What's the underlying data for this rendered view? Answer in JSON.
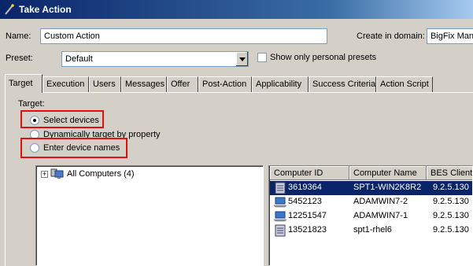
{
  "window": {
    "title": "Take Action"
  },
  "form": {
    "name_label": "Name:",
    "name_value": "Custom Action",
    "domain_label": "Create in domain:",
    "domain_value": "BigFix Mana",
    "preset_label": "Preset:",
    "preset_value": "Default",
    "personal_presets_label": "Show only personal presets",
    "personal_presets_checked": false
  },
  "tabs": [
    {
      "label": "Target",
      "active": true
    },
    {
      "label": "Execution"
    },
    {
      "label": "Users"
    },
    {
      "label": "Messages"
    },
    {
      "label": "Offer"
    },
    {
      "label": "Post-Action"
    },
    {
      "label": "Applicability"
    },
    {
      "label": "Success Criteria"
    },
    {
      "label": "Action Script"
    }
  ],
  "target": {
    "group_label": "Target:",
    "options": [
      {
        "label": "Select devices",
        "selected": true
      },
      {
        "label": "Dynamically target by property",
        "selected": false
      },
      {
        "label": "Enter device names",
        "selected": false
      }
    ]
  },
  "tree": {
    "expander": "+",
    "root_label": "All Computers (4)"
  },
  "computers": {
    "columns": [
      "Computer ID",
      "Computer Name",
      "BES Client Version"
    ],
    "rows": [
      {
        "id": "3619364",
        "name": "SPT1-WIN2K8R2",
        "version": "9.2.5.130",
        "icon": "server-icon",
        "selected": true
      },
      {
        "id": "5452123",
        "name": "ADAMWIN7-2",
        "version": "9.2.5.130",
        "icon": "laptop-icon",
        "selected": false
      },
      {
        "id": "12251547",
        "name": "ADAMWIN7-1",
        "version": "9.2.5.130",
        "icon": "laptop-icon",
        "selected": false
      },
      {
        "id": "13521823",
        "name": "spt1-rhel6",
        "version": "9.2.5.130",
        "icon": "server-icon",
        "selected": false
      }
    ]
  },
  "colors": {
    "titlebar": "#0a246a",
    "selection": "#0a246a",
    "highlight_border": "#e01010"
  }
}
